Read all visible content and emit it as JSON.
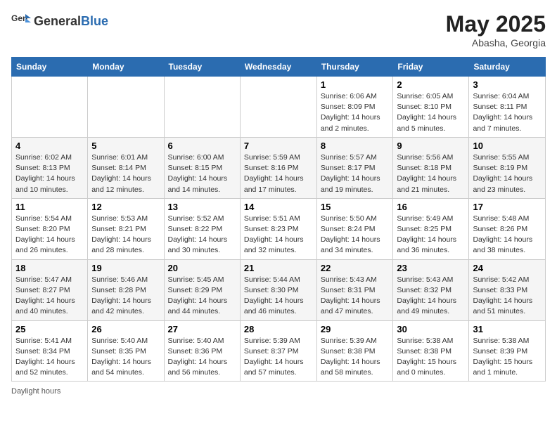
{
  "header": {
    "logo_general": "General",
    "logo_blue": "Blue",
    "title": "May 2025",
    "location": "Abasha, Georgia"
  },
  "days_of_week": [
    "Sunday",
    "Monday",
    "Tuesday",
    "Wednesday",
    "Thursday",
    "Friday",
    "Saturday"
  ],
  "weeks": [
    [
      {
        "day": "",
        "content": ""
      },
      {
        "day": "",
        "content": ""
      },
      {
        "day": "",
        "content": ""
      },
      {
        "day": "",
        "content": ""
      },
      {
        "day": "1",
        "content": "Sunrise: 6:06 AM\nSunset: 8:09 PM\nDaylight: 14 hours and 2 minutes."
      },
      {
        "day": "2",
        "content": "Sunrise: 6:05 AM\nSunset: 8:10 PM\nDaylight: 14 hours and 5 minutes."
      },
      {
        "day": "3",
        "content": "Sunrise: 6:04 AM\nSunset: 8:11 PM\nDaylight: 14 hours and 7 minutes."
      }
    ],
    [
      {
        "day": "4",
        "content": "Sunrise: 6:02 AM\nSunset: 8:13 PM\nDaylight: 14 hours and 10 minutes."
      },
      {
        "day": "5",
        "content": "Sunrise: 6:01 AM\nSunset: 8:14 PM\nDaylight: 14 hours and 12 minutes."
      },
      {
        "day": "6",
        "content": "Sunrise: 6:00 AM\nSunset: 8:15 PM\nDaylight: 14 hours and 14 minutes."
      },
      {
        "day": "7",
        "content": "Sunrise: 5:59 AM\nSunset: 8:16 PM\nDaylight: 14 hours and 17 minutes."
      },
      {
        "day": "8",
        "content": "Sunrise: 5:57 AM\nSunset: 8:17 PM\nDaylight: 14 hours and 19 minutes."
      },
      {
        "day": "9",
        "content": "Sunrise: 5:56 AM\nSunset: 8:18 PM\nDaylight: 14 hours and 21 minutes."
      },
      {
        "day": "10",
        "content": "Sunrise: 5:55 AM\nSunset: 8:19 PM\nDaylight: 14 hours and 23 minutes."
      }
    ],
    [
      {
        "day": "11",
        "content": "Sunrise: 5:54 AM\nSunset: 8:20 PM\nDaylight: 14 hours and 26 minutes."
      },
      {
        "day": "12",
        "content": "Sunrise: 5:53 AM\nSunset: 8:21 PM\nDaylight: 14 hours and 28 minutes."
      },
      {
        "day": "13",
        "content": "Sunrise: 5:52 AM\nSunset: 8:22 PM\nDaylight: 14 hours and 30 minutes."
      },
      {
        "day": "14",
        "content": "Sunrise: 5:51 AM\nSunset: 8:23 PM\nDaylight: 14 hours and 32 minutes."
      },
      {
        "day": "15",
        "content": "Sunrise: 5:50 AM\nSunset: 8:24 PM\nDaylight: 14 hours and 34 minutes."
      },
      {
        "day": "16",
        "content": "Sunrise: 5:49 AM\nSunset: 8:25 PM\nDaylight: 14 hours and 36 minutes."
      },
      {
        "day": "17",
        "content": "Sunrise: 5:48 AM\nSunset: 8:26 PM\nDaylight: 14 hours and 38 minutes."
      }
    ],
    [
      {
        "day": "18",
        "content": "Sunrise: 5:47 AM\nSunset: 8:27 PM\nDaylight: 14 hours and 40 minutes."
      },
      {
        "day": "19",
        "content": "Sunrise: 5:46 AM\nSunset: 8:28 PM\nDaylight: 14 hours and 42 minutes."
      },
      {
        "day": "20",
        "content": "Sunrise: 5:45 AM\nSunset: 8:29 PM\nDaylight: 14 hours and 44 minutes."
      },
      {
        "day": "21",
        "content": "Sunrise: 5:44 AM\nSunset: 8:30 PM\nDaylight: 14 hours and 46 minutes."
      },
      {
        "day": "22",
        "content": "Sunrise: 5:43 AM\nSunset: 8:31 PM\nDaylight: 14 hours and 47 minutes."
      },
      {
        "day": "23",
        "content": "Sunrise: 5:43 AM\nSunset: 8:32 PM\nDaylight: 14 hours and 49 minutes."
      },
      {
        "day": "24",
        "content": "Sunrise: 5:42 AM\nSunset: 8:33 PM\nDaylight: 14 hours and 51 minutes."
      }
    ],
    [
      {
        "day": "25",
        "content": "Sunrise: 5:41 AM\nSunset: 8:34 PM\nDaylight: 14 hours and 52 minutes."
      },
      {
        "day": "26",
        "content": "Sunrise: 5:40 AM\nSunset: 8:35 PM\nDaylight: 14 hours and 54 minutes."
      },
      {
        "day": "27",
        "content": "Sunrise: 5:40 AM\nSunset: 8:36 PM\nDaylight: 14 hours and 56 minutes."
      },
      {
        "day": "28",
        "content": "Sunrise: 5:39 AM\nSunset: 8:37 PM\nDaylight: 14 hours and 57 minutes."
      },
      {
        "day": "29",
        "content": "Sunrise: 5:39 AM\nSunset: 8:38 PM\nDaylight: 14 hours and 58 minutes."
      },
      {
        "day": "30",
        "content": "Sunrise: 5:38 AM\nSunset: 8:38 PM\nDaylight: 15 hours and 0 minutes."
      },
      {
        "day": "31",
        "content": "Sunrise: 5:38 AM\nSunset: 8:39 PM\nDaylight: 15 hours and 1 minute."
      }
    ]
  ],
  "legend": {
    "daylight_hours": "Daylight hours"
  }
}
